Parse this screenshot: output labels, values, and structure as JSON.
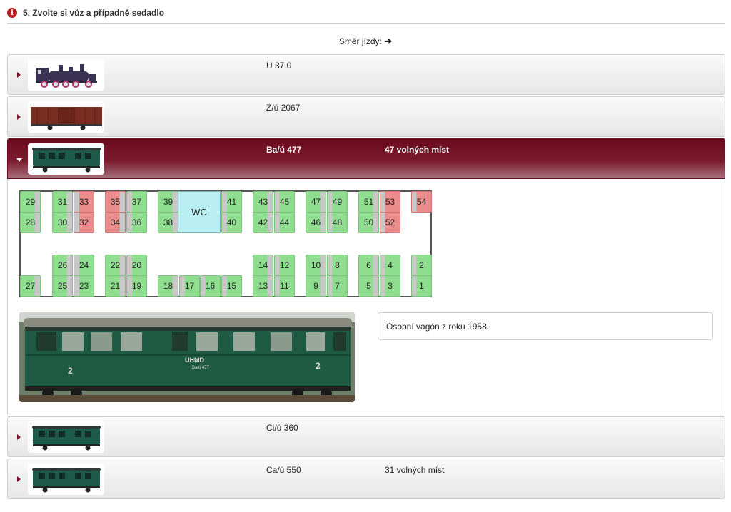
{
  "section": {
    "title": "5. Zvolte si vůz a případně sedadlo",
    "icon": "info-icon"
  },
  "direction": {
    "label": "Směr jízdy:",
    "arrow": "➜"
  },
  "rows": [
    {
      "name": "U 37.0",
      "free": "",
      "thumb": "locomotive-icon"
    },
    {
      "name": "Z/ú 2067",
      "free": "",
      "thumb": "boxcar-icon"
    },
    {
      "name": "Ba/ú 477",
      "free": "47 volných míst",
      "thumb": "green-coach-icon",
      "active": true
    },
    {
      "name": "Ci/ú 360",
      "free": "",
      "thumb": "green-coach-icon"
    },
    {
      "name": "Ca/ú 550",
      "free": "31 volných míst",
      "thumb": "green-coach-icon"
    }
  ],
  "seat_map": {
    "wc_label": "WC",
    "seats": [
      {
        "n": "29",
        "s": "free"
      },
      {
        "n": "28",
        "s": "free"
      },
      {
        "n": "31",
        "s": "free"
      },
      {
        "n": "30",
        "s": "free"
      },
      {
        "n": "33",
        "s": "takenL"
      },
      {
        "n": "32",
        "s": "takenL"
      },
      {
        "n": "35",
        "s": "taken"
      },
      {
        "n": "34",
        "s": "taken"
      },
      {
        "n": "37",
        "s": "freeL"
      },
      {
        "n": "36",
        "s": "freeL"
      },
      {
        "n": "39",
        "s": "free"
      },
      {
        "n": "38",
        "s": "free"
      },
      {
        "n": "41",
        "s": "freeL"
      },
      {
        "n": "40",
        "s": "freeL"
      },
      {
        "n": "43",
        "s": "free"
      },
      {
        "n": "42",
        "s": "free"
      },
      {
        "n": "45",
        "s": "freeL"
      },
      {
        "n": "44",
        "s": "freeL"
      },
      {
        "n": "47",
        "s": "free"
      },
      {
        "n": "46",
        "s": "free"
      },
      {
        "n": "49",
        "s": "freeL"
      },
      {
        "n": "48",
        "s": "freeL"
      },
      {
        "n": "51",
        "s": "free"
      },
      {
        "n": "50",
        "s": "free"
      },
      {
        "n": "53",
        "s": "takenL"
      },
      {
        "n": "52",
        "s": "takenL"
      },
      {
        "n": "54",
        "s": "takenL"
      },
      {
        "n": "26",
        "s": "free"
      },
      {
        "n": "25",
        "s": "free"
      },
      {
        "n": "24",
        "s": "freeL"
      },
      {
        "n": "23",
        "s": "freeL"
      },
      {
        "n": "22",
        "s": "free"
      },
      {
        "n": "21",
        "s": "free"
      },
      {
        "n": "20",
        "s": "freeL"
      },
      {
        "n": "19",
        "s": "freeL"
      },
      {
        "n": "27",
        "s": "free"
      },
      {
        "n": "18",
        "s": "free"
      },
      {
        "n": "17",
        "s": "freeL"
      },
      {
        "n": "16",
        "s": "freeL"
      },
      {
        "n": "15",
        "s": "freeL"
      },
      {
        "n": "14",
        "s": "free"
      },
      {
        "n": "13",
        "s": "free"
      },
      {
        "n": "12",
        "s": "freeL"
      },
      {
        "n": "11",
        "s": "freeL"
      },
      {
        "n": "10",
        "s": "free"
      },
      {
        "n": "9",
        "s": "free"
      },
      {
        "n": "8",
        "s": "freeL"
      },
      {
        "n": "7",
        "s": "freeL"
      },
      {
        "n": "6",
        "s": "free"
      },
      {
        "n": "5",
        "s": "free"
      },
      {
        "n": "4",
        "s": "freeL"
      },
      {
        "n": "3",
        "s": "freeL"
      },
      {
        "n": "2",
        "s": "freeL"
      },
      {
        "n": "1",
        "s": "freeL"
      }
    ]
  },
  "photo": {
    "side_number": "2",
    "logo": "UHMD",
    "caption": "Ba/ú 477"
  },
  "description": "Osobní vagón z roku 1958.",
  "colors": {
    "accent": "#6c0b1e",
    "free_seat": "#8fdd8f",
    "taken_seat": "#ea8c8c",
    "wc": "#b9eef2"
  }
}
